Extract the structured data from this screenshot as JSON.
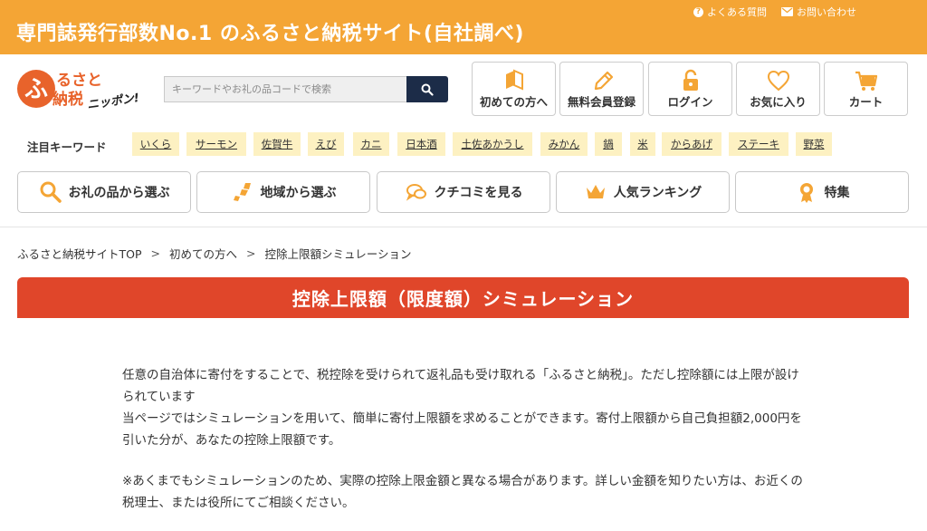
{
  "header": {
    "title": "専門誌発行部数No.1 のふるさと納税サイト(自社調べ)",
    "links": [
      {
        "icon": "question-icon",
        "label": "よくある質問"
      },
      {
        "icon": "mail-icon",
        "label": "お問い合わせ"
      }
    ]
  },
  "logo": {
    "line1": "ふるさと",
    "line2": "納税",
    "tagline": "ニッポン!"
  },
  "search": {
    "placeholder": "キーワードやお礼の品コードで検索",
    "value": ""
  },
  "header_buttons": [
    {
      "icon": "beginner-mark-icon",
      "label": "初めての方へ"
    },
    {
      "icon": "pencil-icon",
      "label": "無料会員登録"
    },
    {
      "icon": "lock-icon",
      "label": "ログイン"
    },
    {
      "icon": "heart-icon",
      "label": "お気に入り"
    },
    {
      "icon": "cart-icon",
      "label": "カート"
    }
  ],
  "keywords": {
    "label": "注目キーワード",
    "items": [
      "いくら",
      "サーモン",
      "佐賀牛",
      "えび",
      "カニ",
      "日本酒",
      "土佐あかうし",
      "みかん",
      "鍋",
      "米",
      "からあげ",
      "ステーキ",
      "野菜"
    ]
  },
  "nav": [
    {
      "icon": "search-icon",
      "label": "お礼の品から選ぶ"
    },
    {
      "icon": "map-icon",
      "label": "地域から選ぶ"
    },
    {
      "icon": "chat-icon",
      "label": "クチコミを見る"
    },
    {
      "icon": "crown-icon",
      "label": "人気ランキング"
    },
    {
      "icon": "medal-icon",
      "label": "特集"
    }
  ],
  "breadcrumb": {
    "items": [
      "ふるさと納税サイトTOP",
      "初めての方へ",
      "控除上限額シミュレーション"
    ],
    "separator": ">"
  },
  "page": {
    "title": "控除上限額（限度額）シミュレーション",
    "paragraphs": [
      "任意の自治体に寄付をすることで、税控除を受けられて返礼品も受け取れる「ふるさと納税」。ただし控除額には上限が設けられています",
      "当ページではシミュレーションを用いて、簡単に寄付上限額を求めることができます。寄付上限額から自己負担額2,000円を引いた分が、あなたの控除上限額です。",
      "※あくまでもシミュレーションのため、実際の控除上限金額と異なる場合があります。詳しい金額を知りたい方は、お近くの税理士、または役所にてご相談ください。"
    ]
  },
  "colors": {
    "header_orange": "#f4a535",
    "banner_red": "#e0462a",
    "search_navy": "#1c2c48",
    "keyword_bg": "#fdf1c2"
  }
}
